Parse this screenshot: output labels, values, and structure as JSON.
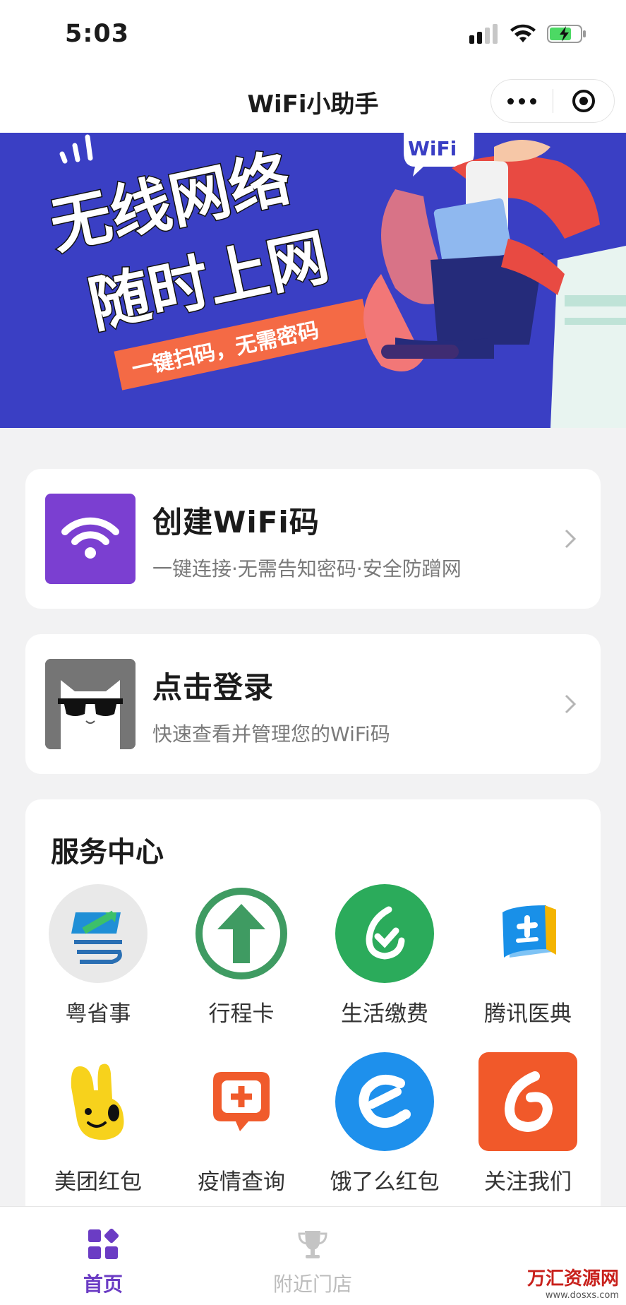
{
  "status_bar": {
    "time": "5:03"
  },
  "navbar": {
    "title": "WiFi小助手"
  },
  "banner": {
    "tag": "WiFi",
    "headline_1": "无线网络",
    "headline_2": "随时上网",
    "ribbon": "一键扫码，无需密码"
  },
  "create_card": {
    "title": "创建WiFi码",
    "subtitle": "一键连接·无需告知密码·安全防蹭网",
    "icon": "wifi-icon",
    "accent": "#7b3fd1"
  },
  "login_card": {
    "title": "点击登录",
    "subtitle": "快速查看并管理您的WiFi码",
    "icon": "avatar-cat-sunglasses"
  },
  "service_center": {
    "title": "服务中心",
    "items": [
      {
        "label": "粤省事",
        "icon": "yue-icon"
      },
      {
        "label": "行程卡",
        "icon": "arrow-up-circle-icon"
      },
      {
        "label": "生活缴费",
        "icon": "payment-icon"
      },
      {
        "label": "腾讯医典",
        "icon": "medical-book-icon"
      },
      {
        "label": "美团红包",
        "icon": "kangaroo-icon"
      },
      {
        "label": "疫情查询",
        "icon": "medical-chat-icon"
      },
      {
        "label": "饿了么红包",
        "icon": "eleme-icon"
      },
      {
        "label": "关注我们",
        "icon": "follow-logo-icon"
      }
    ]
  },
  "tabbar": {
    "tabs": [
      {
        "label": "首页",
        "icon": "home-grid-icon",
        "active": true
      },
      {
        "label": "附近门店",
        "icon": "trophy-icon",
        "active": false
      }
    ],
    "active_color": "#6b3cc4",
    "inactive_color": "#bcbcbc"
  },
  "watermark": {
    "text": "万汇资源网",
    "url": "www.dosxs.com"
  }
}
